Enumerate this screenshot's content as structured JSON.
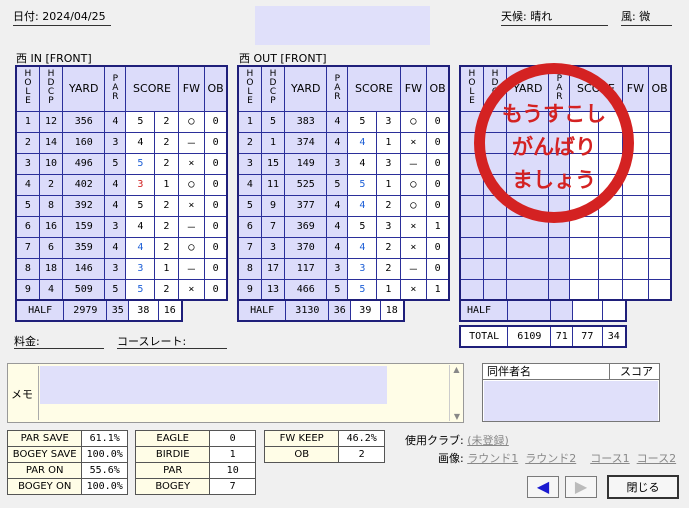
{
  "header": {
    "date": "日付: 2024/04/25",
    "weather": "天候: 晴れ",
    "wind": "風: 微"
  },
  "in": {
    "title": "西 IN [FRONT]",
    "headers": [
      "HOLE",
      "HDCP",
      "YARD",
      "PAR",
      "SCORE",
      "FW",
      "OB"
    ],
    "rows": [
      [
        "1",
        "12",
        "356",
        "4",
        "5",
        "2",
        "◯",
        "0"
      ],
      [
        "2",
        "14",
        "160",
        "3",
        "4",
        "2",
        "－",
        "0"
      ],
      [
        "3",
        "10",
        "496",
        "5",
        "5",
        "2",
        "×",
        "0"
      ],
      [
        "4",
        "2",
        "402",
        "4",
        "3",
        "1",
        "◯",
        "0"
      ],
      [
        "5",
        "8",
        "392",
        "4",
        "5",
        "2",
        "×",
        "0"
      ],
      [
        "6",
        "16",
        "159",
        "3",
        "4",
        "2",
        "－",
        "0"
      ],
      [
        "7",
        "6",
        "359",
        "4",
        "4",
        "2",
        "◯",
        "0"
      ],
      [
        "8",
        "18",
        "146",
        "3",
        "3",
        "1",
        "－",
        "0"
      ],
      [
        "9",
        "4",
        "509",
        "5",
        "5",
        "2",
        "×",
        "0"
      ]
    ],
    "half": [
      "HALF",
      "2979",
      "35",
      "38",
      "16"
    ]
  },
  "out": {
    "title": "西 OUT [FRONT]",
    "headers": [
      "HOLE",
      "HDCP",
      "YARD",
      "PAR",
      "SCORE",
      "FW",
      "OB"
    ],
    "rows": [
      [
        "1",
        "5",
        "383",
        "4",
        "5",
        "3",
        "◯",
        "0"
      ],
      [
        "2",
        "1",
        "374",
        "4",
        "4",
        "1",
        "×",
        "0"
      ],
      [
        "3",
        "15",
        "149",
        "3",
        "4",
        "3",
        "－",
        "0"
      ],
      [
        "4",
        "11",
        "525",
        "5",
        "5",
        "1",
        "◯",
        "0"
      ],
      [
        "5",
        "9",
        "377",
        "4",
        "4",
        "2",
        "◯",
        "0"
      ],
      [
        "6",
        "7",
        "369",
        "4",
        "5",
        "3",
        "×",
        "1"
      ],
      [
        "7",
        "3",
        "370",
        "4",
        "4",
        "2",
        "×",
        "0"
      ],
      [
        "8",
        "17",
        "117",
        "3",
        "3",
        "2",
        "－",
        "0"
      ],
      [
        "9",
        "13",
        "466",
        "5",
        "5",
        "1",
        "×",
        "1"
      ]
    ],
    "half": [
      "HALF",
      "3130",
      "36",
      "39",
      "18"
    ]
  },
  "third": {
    "headers": [
      "HOLE",
      "HDCP",
      "YARD",
      "PAR",
      "SCORE",
      "FW",
      "OB"
    ],
    "half": "HALF",
    "total": [
      "TOTAL",
      "6109",
      "71",
      "77",
      "34"
    ]
  },
  "stamp": {
    "line1": "もうすこし",
    "line2": "がんばり",
    "line3": "ましょう",
    "color": "#d42222"
  },
  "fee": {
    "label": "料金:"
  },
  "course_rate": {
    "label": "コースレート:"
  },
  "memo": {
    "label": "メモ"
  },
  "companions": {
    "col_name": "同伴者名",
    "col_score": "スコア"
  },
  "stats1": [
    [
      "PAR SAVE",
      "61.1%"
    ],
    [
      "BOGEY SAVE",
      "100.0%"
    ],
    [
      "PAR ON",
      "55.6%"
    ],
    [
      "BOGEY ON",
      "100.0%"
    ]
  ],
  "stats2": [
    [
      "EAGLE",
      "0"
    ],
    [
      "BIRDIE",
      "1"
    ],
    [
      "PAR",
      "10"
    ],
    [
      "BOGEY",
      "7"
    ]
  ],
  "stats3": [
    [
      "FW KEEP",
      "46.2%"
    ],
    [
      "OB",
      "2"
    ]
  ],
  "club": {
    "label": "使用クラブ:",
    "value": "(未登録)"
  },
  "images": {
    "label": "画像:",
    "links": [
      "ラウンド1",
      "ラウンド2",
      "コース1",
      "コース2"
    ]
  },
  "buttons": {
    "back": "◀",
    "forward": "▶",
    "close": "閉じる"
  }
}
